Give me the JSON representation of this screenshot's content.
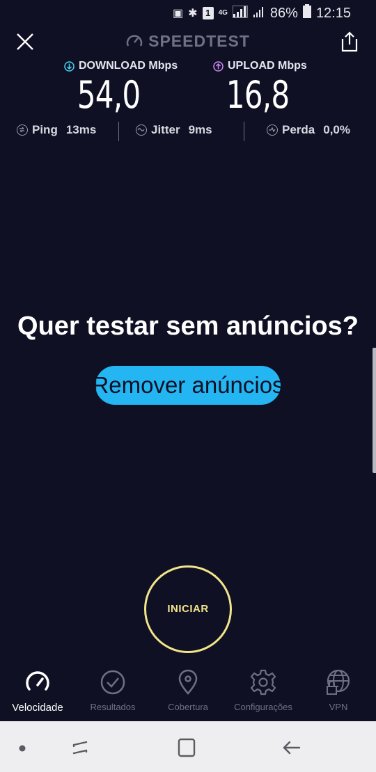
{
  "status_bar": {
    "network": "4G",
    "sim": "1",
    "battery": "86%",
    "time": "12:15"
  },
  "app": {
    "brand": "SPEEDTEST"
  },
  "results": {
    "download": {
      "label": "DOWNLOAD Mbps",
      "value": "54,0",
      "color": "#4ad6f6"
    },
    "upload": {
      "label": "UPLOAD Mbps",
      "value": "16,8",
      "color": "#c98bf2"
    },
    "ping": {
      "label": "Ping",
      "value": "13ms"
    },
    "jitter": {
      "label": "Jitter",
      "value": "9ms"
    },
    "loss": {
      "label": "Perda",
      "value": "0,0%"
    }
  },
  "ad": {
    "title": "Quer testar sem anúncios?",
    "button": "Remover anúncios"
  },
  "go_button": {
    "label": "INICIAR",
    "color": "#f2e48a"
  },
  "nav": {
    "items": [
      {
        "label": "Velocidade",
        "icon": "speedometer-icon",
        "active": true
      },
      {
        "label": "Resultados",
        "icon": "check-circle-icon"
      },
      {
        "label": "Cobertura",
        "icon": "map-pin-icon"
      },
      {
        "label": "Configurações",
        "icon": "gear-icon"
      },
      {
        "label": "VPN",
        "icon": "vpn-globe-lock-icon"
      }
    ]
  },
  "system_nav": [
    "dot",
    "recents",
    "home",
    "back"
  ]
}
